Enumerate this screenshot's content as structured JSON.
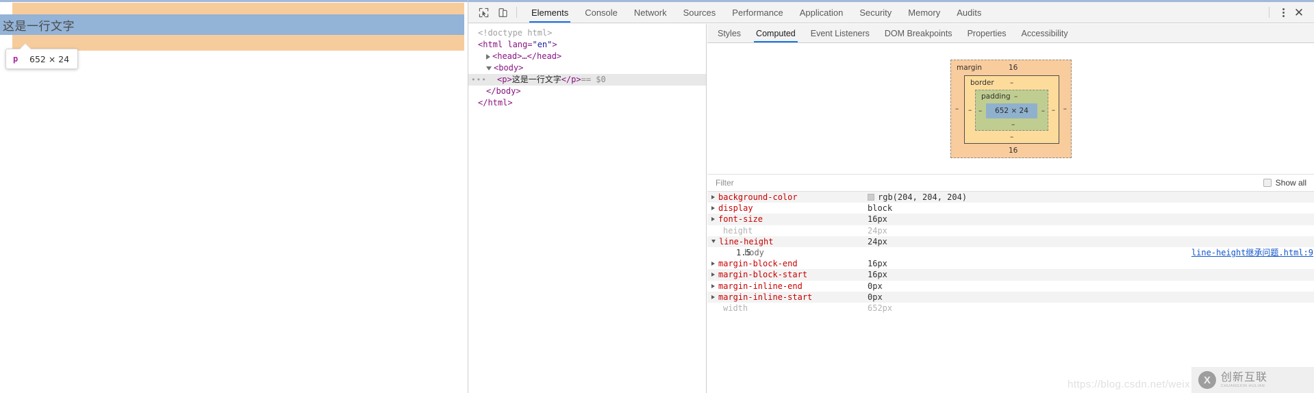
{
  "page": {
    "paragraph_text": "这是一行文字",
    "tooltip": {
      "tag": "p",
      "dimensions": "652 × 24"
    },
    "highlight_colors": {
      "margin": "#f7cc9c",
      "content": "#93b3d7",
      "padding": "#c0cd90",
      "border": "#fddc9b"
    }
  },
  "devtools": {
    "toolbar": {
      "inspect_icon": "inspect-element-icon",
      "device_icon": "device-toolbar-icon",
      "tabs": [
        {
          "label": "Elements",
          "active": true
        },
        {
          "label": "Console",
          "active": false
        },
        {
          "label": "Network",
          "active": false
        },
        {
          "label": "Sources",
          "active": false
        },
        {
          "label": "Performance",
          "active": false
        },
        {
          "label": "Application",
          "active": false
        },
        {
          "label": "Security",
          "active": false
        },
        {
          "label": "Memory",
          "active": false
        },
        {
          "label": "Audits",
          "active": false
        }
      ],
      "more_icon": "kebab-menu-icon",
      "close_icon": "close-icon"
    },
    "dom_tree": {
      "doctype": "<!doctype html>",
      "html_open_1": "<html lang=",
      "html_lang_value": "\"en\"",
      "html_open_2": ">",
      "head_line": "<head>…</head>",
      "body_open": "<body>",
      "p_open": "<p>",
      "p_text": "这是一行文字",
      "p_close": "</p>",
      "selected_marker": "== $0",
      "ellipsis": "•••",
      "body_close": "</body>",
      "html_close": "</html>"
    },
    "sidebar_tabs": [
      {
        "label": "Styles",
        "active": false
      },
      {
        "label": "Computed",
        "active": true
      },
      {
        "label": "Event Listeners",
        "active": false
      },
      {
        "label": "DOM Breakpoints",
        "active": false
      },
      {
        "label": "Properties",
        "active": false
      },
      {
        "label": "Accessibility",
        "active": false
      }
    ],
    "box_model": {
      "margin_label": "margin",
      "margin_top": "16",
      "margin_bottom": "16",
      "margin_left": "–",
      "margin_right": "–",
      "border_label": "border",
      "border_top": "–",
      "border_bottom": "–",
      "border_left": "–",
      "border_right": "–",
      "padding_label": "padding",
      "padding_top": "–",
      "padding_bottom": "–",
      "padding_left": "–",
      "padding_right": "–",
      "content_size": "652 × 24"
    },
    "filter": {
      "placeholder": "Filter",
      "value": "",
      "show_all_label": "Show all",
      "show_all_checked": false
    },
    "computed": [
      {
        "name": "background-color",
        "value": "rgb(204, 204, 204)",
        "swatch": "#cccccc",
        "expandable": true,
        "expanded": false,
        "inherited": false
      },
      {
        "name": "display",
        "value": "block",
        "expandable": true,
        "expanded": false,
        "inherited": false
      },
      {
        "name": "font-size",
        "value": "16px",
        "expandable": true,
        "expanded": false,
        "inherited": false
      },
      {
        "name": "height",
        "value": "24px",
        "expandable": false,
        "expanded": false,
        "inherited": true
      },
      {
        "name": "line-height",
        "value": "24px",
        "expandable": true,
        "expanded": true,
        "inherited": false
      },
      {
        "name": "margin-block-end",
        "value": "16px",
        "expandable": true,
        "expanded": false,
        "inherited": false
      },
      {
        "name": "margin-block-start",
        "value": "16px",
        "expandable": true,
        "expanded": false,
        "inherited": false
      },
      {
        "name": "margin-inline-end",
        "value": "0px",
        "expandable": true,
        "expanded": false,
        "inherited": false
      },
      {
        "name": "margin-inline-start",
        "value": "0px",
        "expandable": true,
        "expanded": false,
        "inherited": false
      },
      {
        "name": "width",
        "value": "652px",
        "expandable": false,
        "expanded": false,
        "inherited": true
      }
    ],
    "line_height_trace": {
      "value": "1.5",
      "selector": "body",
      "source": "line-height继承问题.html:9"
    }
  },
  "watermark": {
    "url_text": "https://blog.csdn.net/weix",
    "brand_mark": "X",
    "brand_cn": "创新互联",
    "brand_en": "CHUANGXIN HULIAN"
  }
}
